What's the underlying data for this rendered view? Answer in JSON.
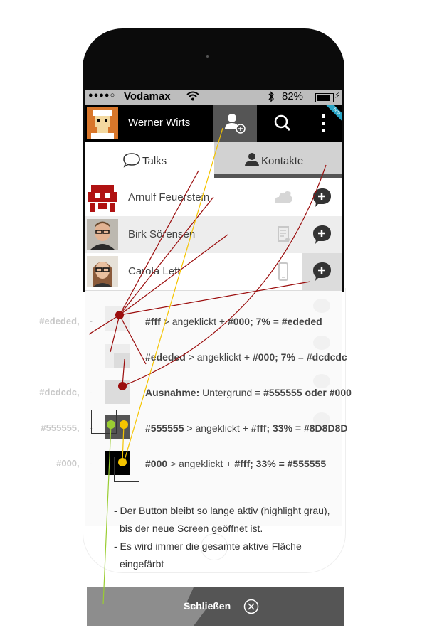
{
  "status_bar": {
    "signal_dots": "●●●●○",
    "carrier": "Vodamax",
    "wifi_icon": "wifi-icon",
    "bluetooth_icon": "bluetooth-icon",
    "battery_percent": "82%",
    "battery_level": 0.82
  },
  "app_header": {
    "user_name": "Werner Wirts",
    "badge": "beta",
    "icons": [
      "add-contact-icon",
      "search-icon",
      "more-menu-icon"
    ],
    "active_button_color": "#555555"
  },
  "tabs": [
    {
      "label": "Talks",
      "icon": "speech-bubble-icon",
      "active": false
    },
    {
      "label": "Kontakte",
      "icon": "person-icon",
      "active": true
    }
  ],
  "contacts": [
    {
      "name": "Arnulf Feuerstein",
      "meta_icon": "cloud-icon",
      "pressed": false
    },
    {
      "name": "Birk Sörensen",
      "meta_icon": "document-icon",
      "pressed": true
    },
    {
      "name": "Carola Left",
      "meta_icon": "phone-icon",
      "pressed": false
    }
  ],
  "legend": [
    {
      "side": "#ededed,",
      "text_html": "<b>#fff</b> &gt; angeklickt + <b>#000;  7%</b> = <b>#ededed</b>"
    },
    {
      "side": "",
      "text_html": "<b>#ededed</b> &gt; angeklickt + <b>#000; 7%</b>  = <b>#dcdcdc</b>"
    },
    {
      "side": "#dcdcdc,",
      "text_html": "<b>Ausnahme:</b> Untergrund = <b>#555555 oder #000</b>"
    },
    {
      "side": "#555555,",
      "text_html": "<b>#555555</b> &gt; angeklickt  + <b>#fff; 33% = #8D8D8D</b>"
    },
    {
      "side": "#000,",
      "text_html": "<b>#000</b> &gt; angeklickt  + <b>#fff; 33% = #555555</b>"
    }
  ],
  "notes": {
    "line1": "- Der Button bleibt so lange aktiv (highlight grau),",
    "line2": "bis der neue Screen geöffnet ist.",
    "line3": "- Es wird immer die gesamte aktive Fläche",
    "line4": "eingefärbt"
  },
  "close_bar": {
    "label": "Schließen",
    "icon": "close-circle-icon"
  },
  "colors": {
    "pressed_light": "#ededed",
    "pressed_dark": "#dcdcdc",
    "active_dark": "#555555",
    "marker_red": "#9b0d0d",
    "marker_yellow": "#f5c400",
    "marker_green": "#9acd32"
  }
}
